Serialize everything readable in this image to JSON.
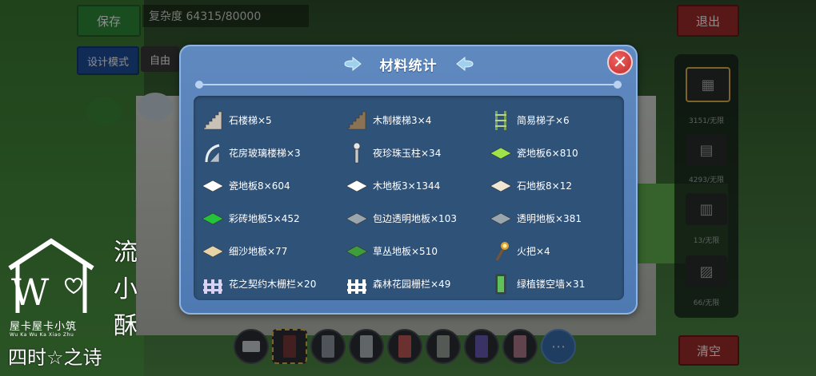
{
  "hud": {
    "save": "保存",
    "complexity": "复杂度 64315/80000",
    "design_mode": "设计模式",
    "free_mode": "自由",
    "exit": "退出",
    "clear": "清空",
    "side_counts": [
      "3151/无限",
      "4293/无限",
      "13/无限",
      "66/无限"
    ]
  },
  "watermark": {
    "brand": "屋卡屋卡小筑",
    "brand_sub": "Wu Ka Wu Ka Xiao Zhu",
    "poem": "四时☆之诗",
    "name_chars": [
      "流",
      "小",
      "酥"
    ]
  },
  "dialog": {
    "title": "材料统计",
    "close": "✕",
    "materials": [
      {
        "label": "石楼梯×5",
        "icon": "stone-stairs-icon",
        "color": "#c9c2b6"
      },
      {
        "label": "木制楼梯3×4",
        "icon": "wood-stairs-icon",
        "color": "#8a7355"
      },
      {
        "label": "简易梯子×6",
        "icon": "ladder-icon",
        "color": "#7aa05a"
      },
      {
        "label": "花房玻璃楼梯×3",
        "icon": "glass-stairs-icon",
        "color": "#e8eef2"
      },
      {
        "label": "夜珍珠玉柱×34",
        "icon": "pearl-pillar-icon",
        "color": "#e6e6e6"
      },
      {
        "label": "瓷地板6×810",
        "icon": "tile-floor-icon",
        "color": "#9ee34a"
      },
      {
        "label": "瓷地板8×604",
        "icon": "tile-floor-icon",
        "color": "#ffffff"
      },
      {
        "label": "木地板3×1344",
        "icon": "tile-floor-icon",
        "color": "#ffffff"
      },
      {
        "label": "石地板8×12",
        "icon": "tile-floor-icon",
        "color": "#efe6d6"
      },
      {
        "label": "彩砖地板5×452",
        "icon": "tile-floor-icon",
        "color": "#26c23a"
      },
      {
        "label": "包边透明地板×103",
        "icon": "tile-floor-icon",
        "color": "#9aa6ad"
      },
      {
        "label": "透明地板×381",
        "icon": "tile-floor-icon",
        "color": "#9aa6ad"
      },
      {
        "label": "细沙地板×77",
        "icon": "tile-floor-icon",
        "color": "#e8d3a8"
      },
      {
        "label": "草丛地板×510",
        "icon": "tile-floor-icon",
        "color": "#3f9c3a"
      },
      {
        "label": "火把×4",
        "icon": "torch-icon",
        "color": "#e0a030"
      },
      {
        "label": "花之契约木栅栏×20",
        "icon": "fence-icon",
        "color": "#d9d2f2"
      },
      {
        "label": "森林花园栅栏×49",
        "icon": "fence-icon",
        "color": "#ffffff"
      },
      {
        "label": "绿植镂空墙×31",
        "icon": "plant-wall-icon",
        "color": "#5fc15a"
      }
    ]
  }
}
